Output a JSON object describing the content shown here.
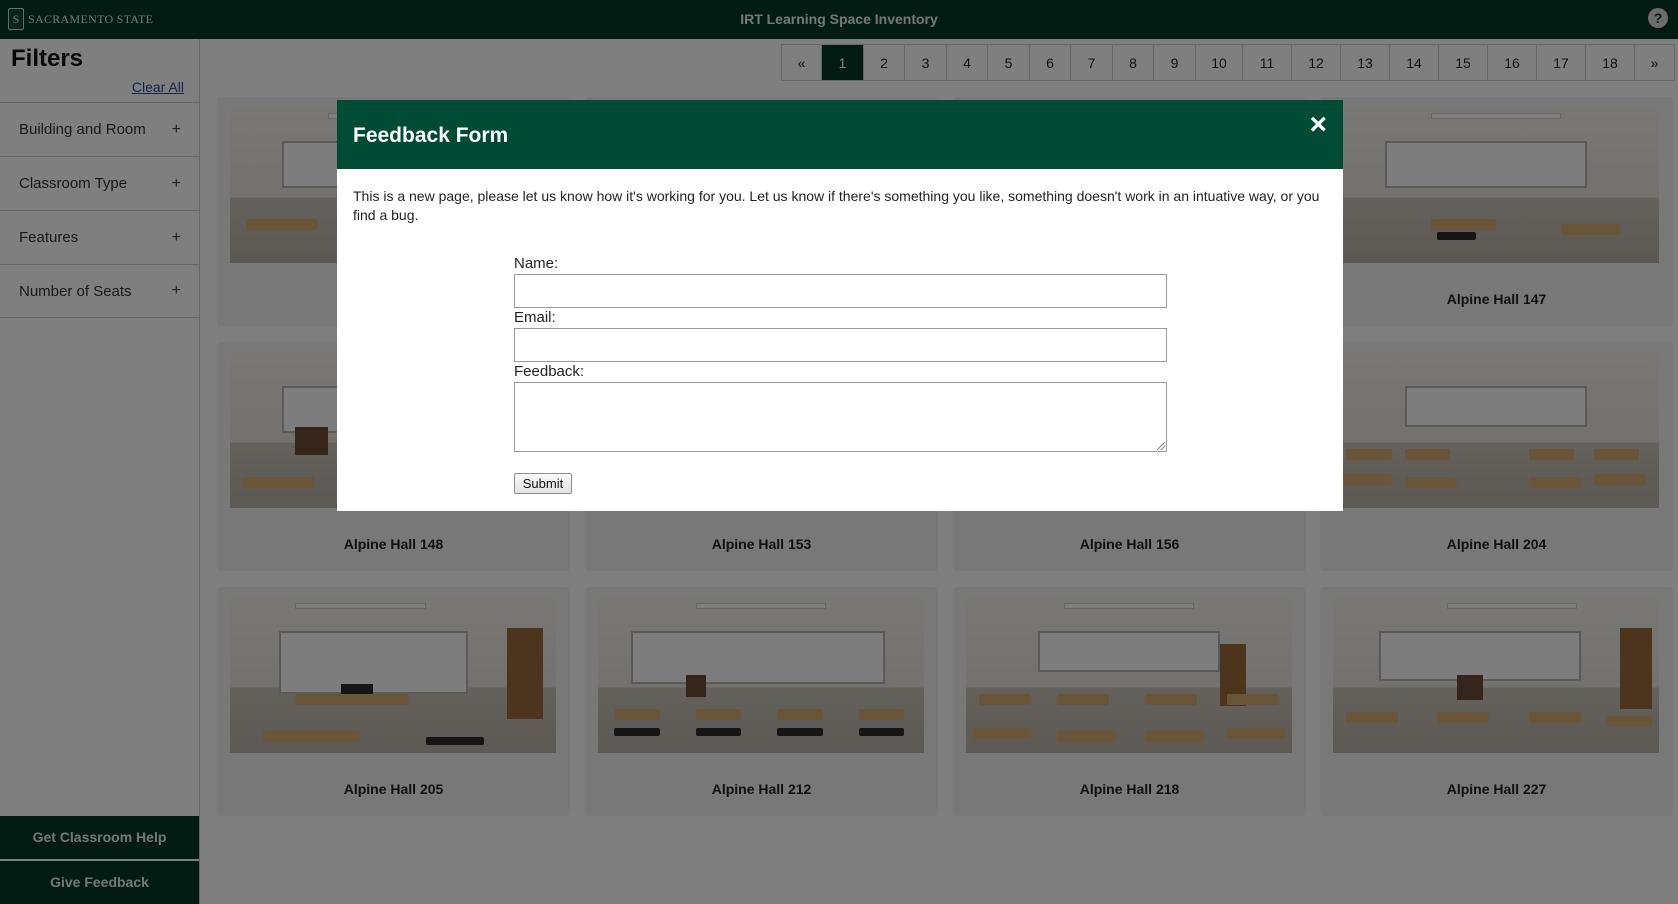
{
  "header": {
    "brand": "SACRAMENTO STATE",
    "title": "IRT Learning Space Inventory",
    "help_icon": "?",
    "accent_color": "#043927"
  },
  "sidebar": {
    "title": "Filters",
    "clear_all": "Clear All",
    "filters": [
      {
        "label": "Building and Room",
        "toggle": "+"
      },
      {
        "label": "Classroom Type",
        "toggle": "+"
      },
      {
        "label": "Features",
        "toggle": "+"
      },
      {
        "label": "Number of Seats",
        "toggle": "+"
      }
    ],
    "help_button": "Get Classroom Help",
    "feedback_button": "Give Feedback"
  },
  "pagination": {
    "prev": "«",
    "pages": [
      "1",
      "2",
      "3",
      "4",
      "5",
      "6",
      "7",
      "8",
      "9",
      "10",
      "11",
      "12",
      "13",
      "14",
      "15",
      "16",
      "17",
      "18"
    ],
    "next": "»",
    "active_page": "1"
  },
  "rooms": {
    "row1_right": "Alpine Hall 147",
    "row2": [
      "Alpine Hall 148",
      "Alpine Hall 153",
      "Alpine Hall 156",
      "Alpine Hall 204"
    ],
    "row3": [
      "Alpine Hall 205",
      "Alpine Hall 212",
      "Alpine Hall 218",
      "Alpine Hall 227"
    ]
  },
  "modal": {
    "title": "Feedback Form",
    "close": "×",
    "intro": "This is a new page, please let us know how it's working for you. Let us know if there's something you like, something doesn't work in an intuative way, or you find a bug.",
    "name_label": "Name:",
    "name_value": "",
    "email_label": "Email:",
    "email_value": "",
    "feedback_label": "Feedback:",
    "feedback_value": "",
    "submit_label": "Submit",
    "header_color": "#004b34"
  }
}
